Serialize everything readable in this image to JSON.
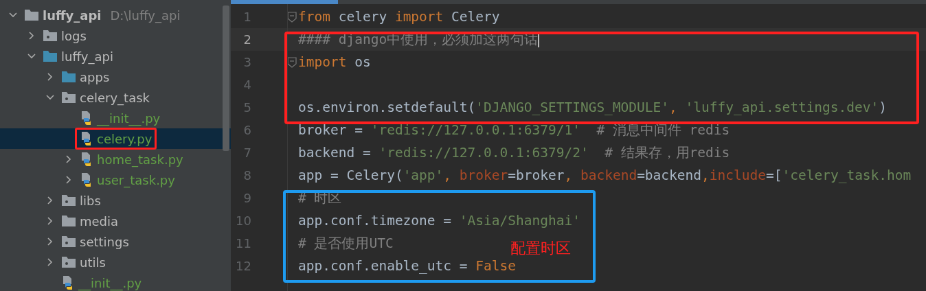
{
  "project_tree": [
    {
      "name": "luffy_api",
      "path": "D:\\luffy_api",
      "kind": "folder",
      "expanded": true,
      "root": true,
      "children": [
        {
          "name": "logs",
          "kind": "package",
          "expanded": false
        },
        {
          "name": "luffy_api",
          "kind": "source",
          "expanded": true,
          "children": [
            {
              "name": "apps",
              "kind": "source",
              "expanded": false
            },
            {
              "name": "celery_task",
              "kind": "package",
              "expanded": true,
              "children": [
                {
                  "name": "__init__.py",
                  "kind": "python",
                  "selected": false,
                  "circled": false
                },
                {
                  "name": "celery.py",
                  "kind": "python",
                  "selected": true,
                  "circled": true
                },
                {
                  "name": "home_task.py",
                  "kind": "python",
                  "expanded": false,
                  "selected": false,
                  "circled": false
                },
                {
                  "name": "user_task.py",
                  "kind": "python",
                  "expanded": false,
                  "selected": false,
                  "circled": false
                }
              ]
            },
            {
              "name": "libs",
              "kind": "package",
              "expanded": false
            },
            {
              "name": "media",
              "kind": "folder",
              "expanded": false
            },
            {
              "name": "settings",
              "kind": "package",
              "expanded": false
            },
            {
              "name": "utils",
              "kind": "package",
              "expanded": false
            },
            {
              "name": "__init__.py",
              "kind": "python",
              "selected": false,
              "circled": false
            }
          ]
        }
      ]
    }
  ],
  "editor": {
    "lines": [
      {
        "number": "1",
        "current": false,
        "fold": true,
        "tokens": [
          {
            "kind": "keyword",
            "text": "from"
          },
          {
            "kind": "plain",
            "text": " celery "
          },
          {
            "kind": "keyword",
            "text": "import"
          },
          {
            "kind": "plain",
            "text": " Celery"
          }
        ]
      },
      {
        "number": "2",
        "current": true,
        "fold": false,
        "tokens": [
          {
            "kind": "comment",
            "text": "#### django中使用，必须加这两句话"
          }
        ]
      },
      {
        "number": "3",
        "current": false,
        "fold": true,
        "tokens": [
          {
            "kind": "keyword",
            "text": "import"
          },
          {
            "kind": "plain",
            "text": " os"
          }
        ]
      },
      {
        "number": "4",
        "current": false,
        "fold": false
      },
      {
        "number": "5",
        "current": false,
        "fold": false,
        "tokens": [
          {
            "kind": "plain",
            "text": "os.environ.setdefault("
          },
          {
            "kind": "string",
            "text": "'DJANGO_SETTINGS_MODULE'"
          },
          {
            "kind": "keyword",
            "text": ", "
          },
          {
            "kind": "string",
            "text": "'luffy_api.settings.dev'"
          },
          {
            "kind": "plain",
            "text": ")"
          }
        ]
      },
      {
        "number": "6",
        "current": false,
        "fold": false,
        "tokens": [
          {
            "kind": "plain",
            "text": "broker = "
          },
          {
            "kind": "string",
            "text": "'redis://127.0.0.1:6379/1'"
          },
          {
            "kind": "comment",
            "text": "  # 消息中间件 redis"
          }
        ]
      },
      {
        "number": "7",
        "current": false,
        "fold": false,
        "tokens": [
          {
            "kind": "plain",
            "text": "backend = "
          },
          {
            "kind": "string",
            "text": "'redis://127.0.0.1:6379/2'"
          },
          {
            "kind": "comment",
            "text": "  # 结果存，用redis"
          }
        ]
      },
      {
        "number": "8",
        "current": false,
        "fold": false,
        "tokens": [
          {
            "kind": "plain",
            "text": "app = Celery("
          },
          {
            "kind": "string",
            "text": "'app'"
          },
          {
            "kind": "keyword",
            "text": ", "
          },
          {
            "kind": "param",
            "text": "broker"
          },
          {
            "kind": "plain",
            "text": "=broker"
          },
          {
            "kind": "keyword",
            "text": ", "
          },
          {
            "kind": "param",
            "text": "backend"
          },
          {
            "kind": "plain",
            "text": "=backend"
          },
          {
            "kind": "keyword",
            "text": ","
          },
          {
            "kind": "param",
            "text": "include"
          },
          {
            "kind": "plain",
            "text": "=["
          },
          {
            "kind": "string",
            "text": "'celery_task.hom"
          }
        ]
      },
      {
        "number": "9",
        "current": false,
        "fold": false,
        "tokens": [
          {
            "kind": "comment",
            "text": "# 时区"
          }
        ]
      },
      {
        "number": "10",
        "current": false,
        "fold": false,
        "tokens": [
          {
            "kind": "plain",
            "text": "app.conf.timezone = "
          },
          {
            "kind": "string",
            "text": "'Asia/Shanghai'"
          }
        ]
      },
      {
        "number": "11",
        "current": false,
        "fold": false,
        "tokens": [
          {
            "kind": "comment",
            "text": "# 是否使用UTC"
          }
        ]
      },
      {
        "number": "12",
        "current": false,
        "fold": false,
        "tokens": [
          {
            "kind": "plain",
            "text": "app.conf.enable_utc = "
          },
          {
            "kind": "keyword",
            "text": "False"
          }
        ]
      }
    ]
  },
  "annotations": [
    {
      "kind": "box",
      "color": "#ff2020"
    },
    {
      "kind": "box",
      "color": "#1e9bf0",
      "label": "配置时区"
    }
  ]
}
